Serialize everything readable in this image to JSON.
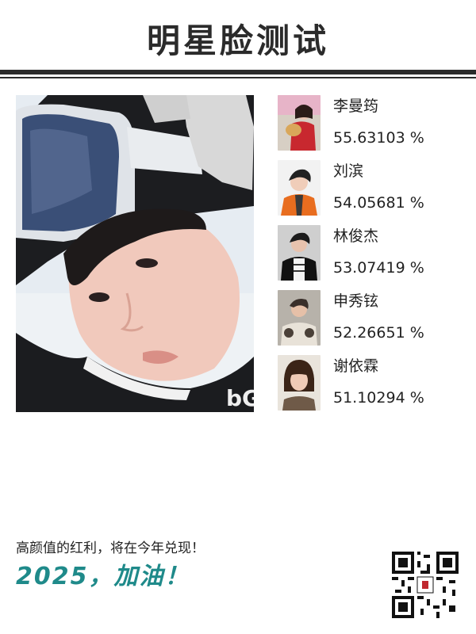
{
  "header": {
    "title": "明星脸测试"
  },
  "matches": [
    {
      "name": "李曼筠",
      "score": "55.63103 %"
    },
    {
      "name": "刘滨",
      "score": "54.05681 %"
    },
    {
      "name": "林俊杰",
      "score": "53.07419 %"
    },
    {
      "name": "申秀铉",
      "score": "52.26651 %"
    },
    {
      "name": "谢依霖",
      "score": "51.10294 %"
    }
  ],
  "footer": {
    "slogan": "高颜值的红利，将在今年兑现！",
    "cheer": "2025，加油！"
  },
  "colors": {
    "accent": "#1f8a8a",
    "title": "#2b2b2b"
  }
}
